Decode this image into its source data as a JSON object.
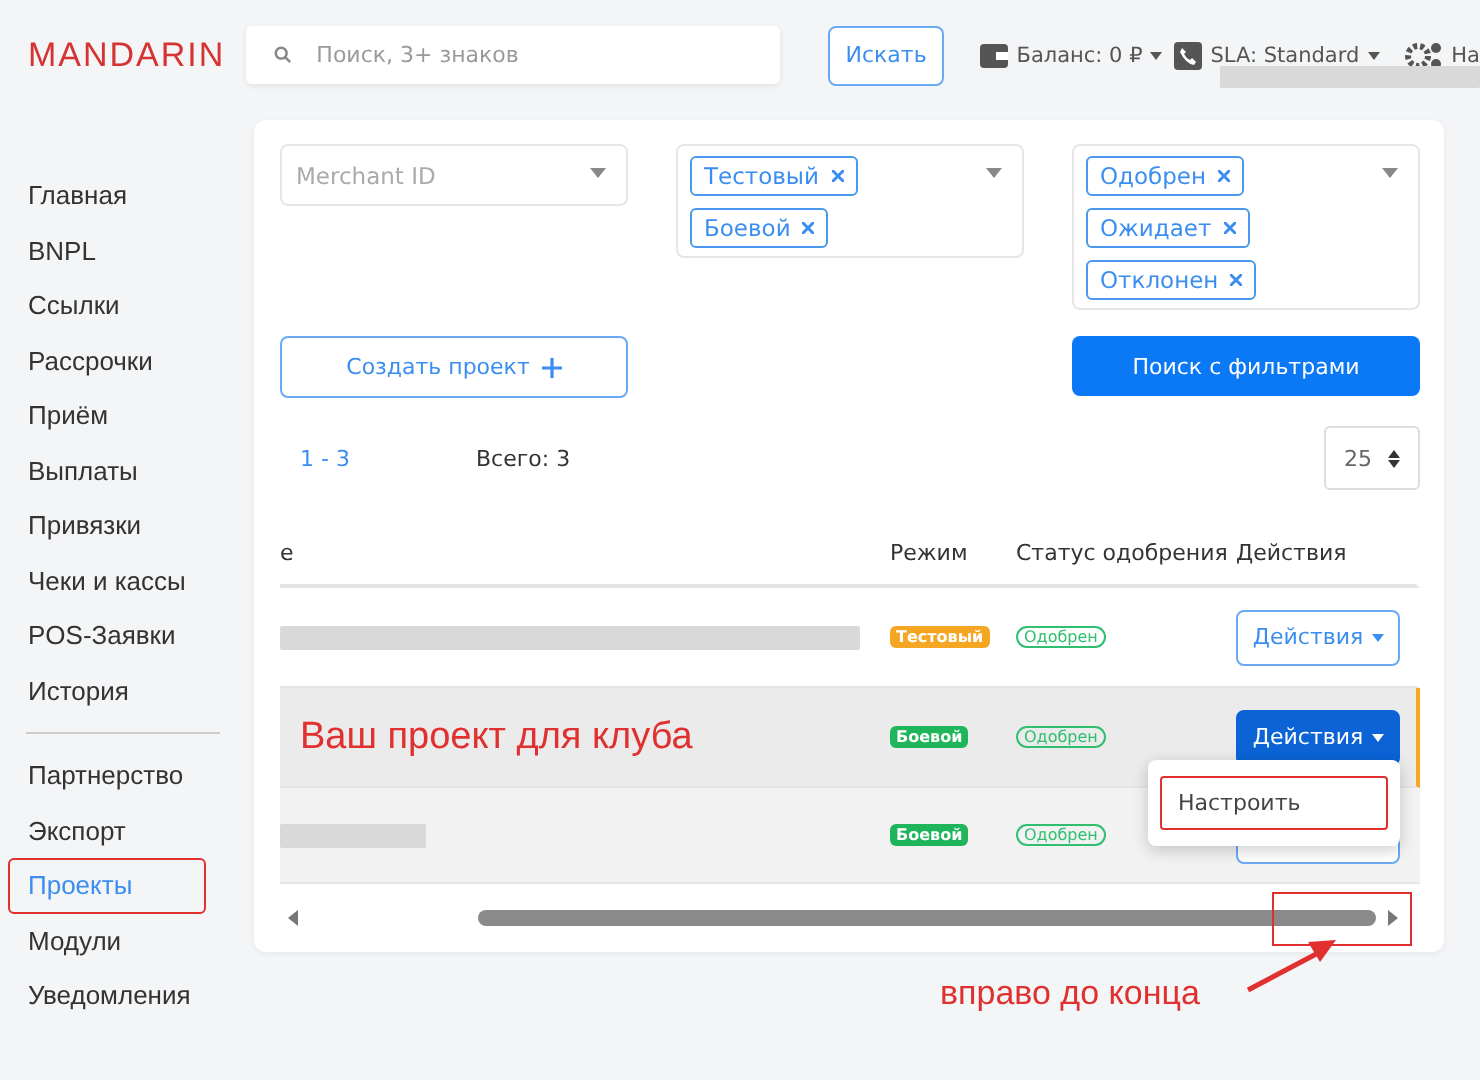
{
  "header": {
    "logo": "MANDARIN",
    "search": {
      "placeholder": "Поиск, 3+ знаков"
    },
    "search_button": "Искать",
    "balance": "Баланс: 0 ₽",
    "sla": "SLA: Standard",
    "settings_label": "На"
  },
  "sidebar": {
    "groups": [
      {
        "items": [
          {
            "label": "Главная",
            "selected": false,
            "highlighted": false
          },
          {
            "label": "BNPL",
            "selected": false,
            "highlighted": false
          },
          {
            "label": "Ссылки",
            "selected": false,
            "highlighted": false
          },
          {
            "label": "Рассрочки",
            "selected": false,
            "highlighted": false
          },
          {
            "label": "Приём",
            "selected": false,
            "highlighted": false
          },
          {
            "label": "Выплаты",
            "selected": false,
            "highlighted": false
          },
          {
            "label": "Привязки",
            "selected": false,
            "highlighted": false
          },
          {
            "label": "Чеки и кассы",
            "selected": false,
            "highlighted": false
          },
          {
            "label": "POS-Заявки",
            "selected": false,
            "highlighted": false
          },
          {
            "label": "История",
            "selected": false,
            "highlighted": false
          }
        ]
      },
      {
        "items": [
          {
            "label": "Партнерство",
            "selected": false,
            "highlighted": false
          },
          {
            "label": "Экспорт",
            "selected": false,
            "highlighted": false
          },
          {
            "label": "Проекты",
            "selected": true,
            "highlighted": true
          },
          {
            "label": "Модули",
            "selected": false,
            "highlighted": false
          },
          {
            "label": "Уведомления",
            "selected": false,
            "highlighted": false
          }
        ]
      }
    ]
  },
  "filters": [
    {
      "placeholder": "Merchant ID"
    },
    {
      "tags": [
        "Тестовый",
        "Боевой"
      ]
    },
    {
      "tags": [
        "Одобрен",
        "Ожидает",
        "Отклонен"
      ]
    }
  ],
  "create_button": "Создать проект",
  "search_filters_button": "Поиск с фильтрами",
  "pagination": {
    "range": "1 - 3",
    "total": "Всего: 3",
    "page_size": "25"
  },
  "table": {
    "columns": [
      "е",
      "Режим",
      "Статус одобрения",
      "Действия"
    ],
    "rows": [
      {
        "name": null,
        "mode": {
          "label": "Тестовый",
          "color": "#f5a623"
        },
        "status": "Одобрен",
        "action": "Действия",
        "selected": false
      },
      {
        "name": "Ваш проект для клуба",
        "mode": {
          "label": "Боевой",
          "color": "#1fb55a"
        },
        "status": "Одобрен",
        "action": "Действия",
        "selected": true
      },
      {
        "name": null,
        "mode": {
          "label": "Боевой",
          "color": "#1fb55a"
        },
        "status": "Одобрен",
        "selected": false
      }
    ],
    "menu": {
      "items": [
        {
          "label": "Настроить",
          "highlighted": true
        }
      ]
    },
    "scroll_right_highlighted": true
  },
  "annotation": {
    "text": "вправо до конца"
  }
}
